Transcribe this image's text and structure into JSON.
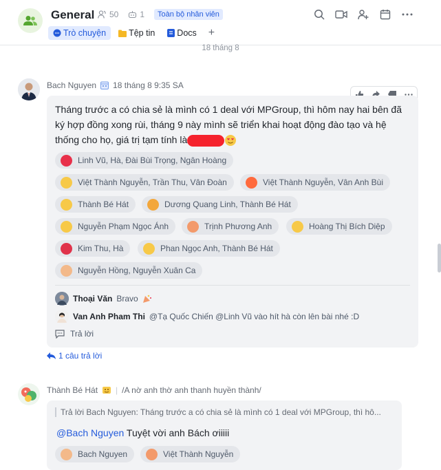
{
  "header": {
    "title": "General",
    "member_count": "50",
    "bot_count": "1",
    "badge": "Toàn bộ nhân viên",
    "tabs": [
      {
        "label": "Trò chuyện",
        "active": true
      },
      {
        "label": "Tệp tin",
        "active": false
      },
      {
        "label": "Docs",
        "active": false
      }
    ],
    "add_tab": "+"
  },
  "date_divider": "18 tháng 8",
  "message1": {
    "sender": "Bach Nguyen",
    "time": "18 tháng 8 9:35 SA",
    "text_line1": "Tháng trước a có chia sẻ là mình có 1 deal với MPGroup, thì hôm nay hai bên đã",
    "text_line2": "ký hợp đồng xong rùi, tháng 9 này mình sẽ triển khai hoạt động đào tạo và hệ",
    "text_line3": "thống cho họ, giá trị tạm tính là",
    "reactions": [
      {
        "users": "Linh Vũ, Hà, Đài Bùi Trọng, Ngân Hoàng",
        "icon": "heart-icon",
        "color": "#e8304a"
      },
      {
        "users": "Việt Thành Nguyễn, Trần Thu, Vân Đoàn",
        "icon": "dizzy-face-icon",
        "color": "#f7c948"
      },
      {
        "users": "Việt Thành Nguyễn, Vân Anh Bùi",
        "icon": "fireworks-icon",
        "color": "#ff6a3d"
      },
      {
        "users": "Thành Bé Hát",
        "icon": "smile-icon",
        "color": "#f7c948"
      },
      {
        "users": "Dương Quang Linh, Thành Bé Hát",
        "icon": "party-popper-icon",
        "color": "#f3a73b"
      },
      {
        "users": "Nguyễn Phạm Ngọc Ánh",
        "icon": "heart-eyes-icon",
        "color": "#f7c948"
      },
      {
        "users": "Trịnh Phương Anh",
        "icon": "cracker-icon",
        "color": "#f39a6b"
      },
      {
        "users": "Hoàng Thị Bích Diệp",
        "icon": "grin-sweat-icon",
        "color": "#f7c948"
      },
      {
        "users": "Kim Thu, Hà",
        "icon": "rose-icon",
        "color": "#e0324a"
      },
      {
        "users": "Phan Ngọc Anh, Thành Bé Hát",
        "icon": "kiss-icon",
        "color": "#f7c948"
      },
      {
        "users": "Nguyễn Hồng, Nguyễn Xuân Ca",
        "icon": "flex-arm-icon",
        "color": "#f3b98a"
      }
    ],
    "replies": [
      {
        "name": "Thoại Văn",
        "text": "Bravo"
      },
      {
        "name": "Van Anh Pham Thi",
        "text": "@Tạ Quốc Chiến @Linh Vũ vào hít hà còn lên bài nhé :D"
      }
    ],
    "reply_action": "Trả lời",
    "thread_link": "1 câu trả lời"
  },
  "message2": {
    "sender": "Thành Bé Hát",
    "status": "/A nờ anh thờ anh thanh huyền thành/",
    "quote": "Trả lời Bach Nguyen:  Tháng trước a có chia sẻ là mình có 1 deal với MPGroup, thì hô...",
    "mention": "@Bach Nguyen",
    "text": "Tuyệt vời anh Bách ơiiiii",
    "reactions": [
      {
        "users": "Bach Nguyen",
        "icon": "flex-arm-icon",
        "color": "#f3b98a"
      },
      {
        "users": "Việt Thành Nguyễn",
        "icon": "clap-icon",
        "color": "#f39a6b"
      }
    ]
  },
  "colors": {
    "accent": "#245bdb",
    "bubble": "#f2f3f5",
    "chip": "#e4e6ea"
  }
}
